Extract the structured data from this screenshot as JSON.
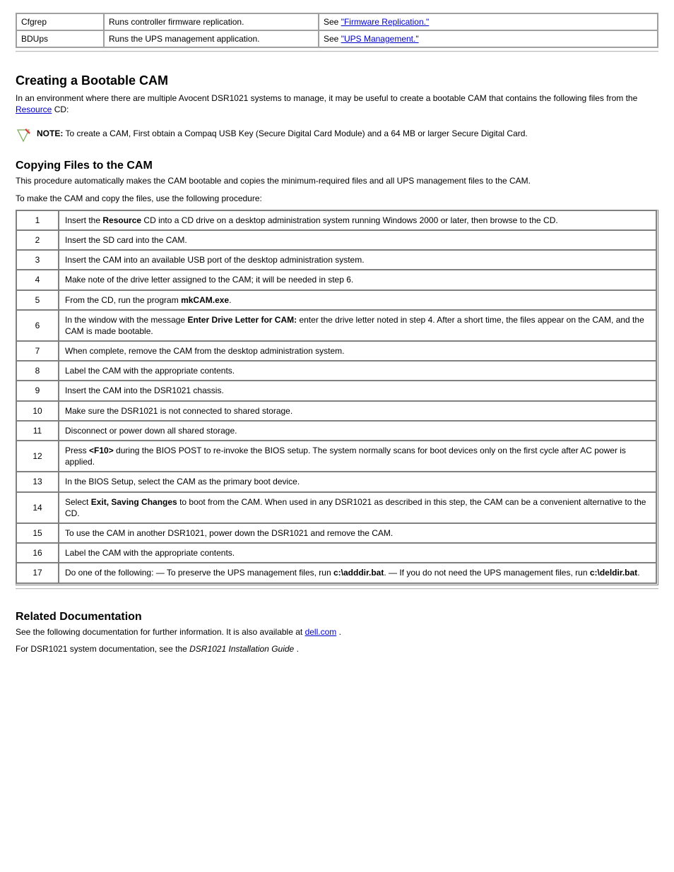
{
  "top_table": {
    "rows": [
      {
        "c1": "Cfgrep",
        "c2": "Runs controller firmware replication.",
        "c3_pre": "See ",
        "c3_link": "\"Firmware Replication.\""
      },
      {
        "c1": "BDUps",
        "c2": "Runs the UPS management application.",
        "c3_pre": "See ",
        "c3_link": "\"UPS Management.\""
      }
    ]
  },
  "section": {
    "title": "Creating a Bootable CAM",
    "lead_pre": "In an environment where there are multiple Avocent DSR1021 systems to manage, it may be useful to create a bootable CAM that contains the following files from the ",
    "lead_link": "Resource",
    "lead_post": " CD:"
  },
  "note": {
    "label": "NOTE:",
    "body": " To create a CAM, First obtain a Compaq USB Key (Secure Digital Card Module) and a 64 MB or larger Secure Digital Card."
  },
  "copy": {
    "heading": "Copying Files to the CAM",
    "p1": "This procedure automatically makes the CAM bootable and copies the minimum-required files and all UPS management files to the CAM.",
    "p2": "To make the CAM and copy the files, use the following procedure:"
  },
  "steps": [
    {
      "n": "1",
      "txt_pre": "Insert the ",
      "txt_b": "Resource",
      "txt_post": " CD into a CD drive on a desktop administration system running Windows 2000 or later, then browse to the CD."
    },
    {
      "n": "2",
      "txt_plain": "Insert the SD card into the CAM."
    },
    {
      "n": "3",
      "txt_plain": "Insert the CAM into an available USB port of the desktop administration system."
    },
    {
      "n": "4",
      "txt_plain": "Make note of the drive letter assigned to the CAM; it will be needed in step 6."
    },
    {
      "n": "5",
      "txt_pre": "From the CD, run the program ",
      "txt_b": "mkCAM.exe",
      "txt_post": "."
    },
    {
      "n": "6",
      "txt_pre": "In the window with the message ",
      "txt_b": "Enter Drive Letter for CAM:",
      "txt_post": " enter the drive letter noted in step 4. After a short time, the files appear on the CAM, and the CAM is made bootable."
    },
    {
      "n": "7",
      "txt_plain": "When complete, remove the CAM from the desktop administration system."
    },
    {
      "n": "8",
      "txt_plain": "Label the CAM with the appropriate contents."
    },
    {
      "n": "9",
      "txt_plain": "Insert the CAM into the DSR1021 chassis."
    },
    {
      "n": "10",
      "txt_plain": "Make sure the DSR1021 is not connected to shared storage."
    },
    {
      "n": "11",
      "txt_plain": "Disconnect or power down all shared storage."
    },
    {
      "n": "12",
      "txt_pre": "Press ",
      "txt_b": "<F10>",
      "txt_post": " during the BIOS POST to re-invoke the BIOS setup. The system normally scans for boot devices only on the first cycle after AC power is applied."
    },
    {
      "n": "13",
      "txt_plain": "In the BIOS Setup, select the CAM as the primary boot device."
    },
    {
      "n": "14",
      "txt_pre": "Select ",
      "txt_b": "Exit, Saving Changes",
      "txt_post": " to boot from the CAM. When used in any DSR1021 as described in this step, the CAM can be a convenient alternative to the CD."
    },
    {
      "n": "15",
      "txt_plain": "To use the CAM in another DSR1021, power down the DSR1021 and remove the CAM."
    },
    {
      "n": "16",
      "txt_plain": "Label the CAM with the appropriate contents."
    },
    {
      "n": "17",
      "txt_pre": "Do one of the following:\n— To preserve the UPS management files, run ",
      "txt_b": "c:\\adddir.bat",
      "txt_mid": ".\n— If you do not need the UPS management files, run ",
      "txt_b2": "c:\\deldir.bat",
      "txt_post2": "."
    }
  ],
  "related": {
    "heading": "Related Documentation",
    "p_pre": "See the following documentation for further information. It is also available at ",
    "p_link": "dell.com",
    "p_post": ".",
    "i1_pre": "For DSR1021 system documentation, see the ",
    "i1_i": "DSR1021 Installation Guide",
    "i1_post": "."
  }
}
